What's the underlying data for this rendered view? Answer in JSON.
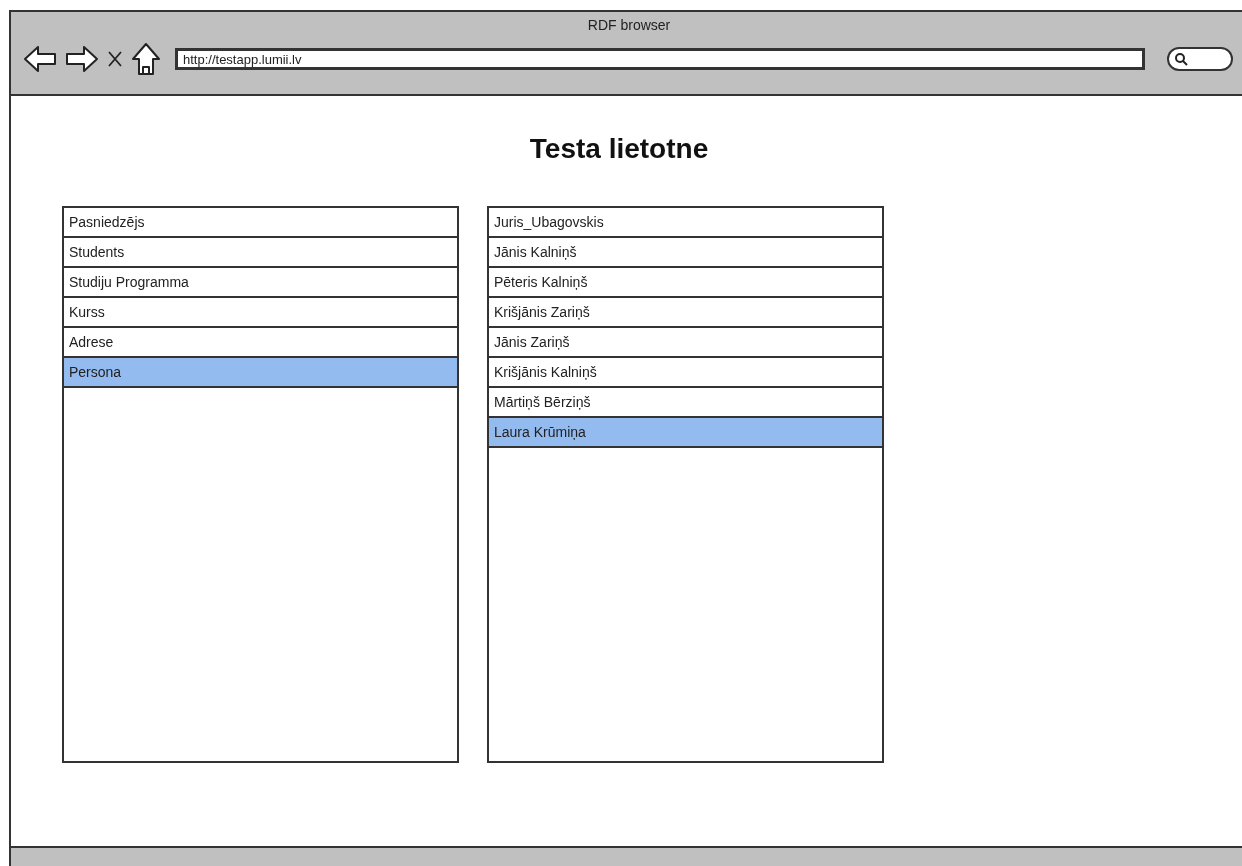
{
  "window": {
    "title": "RDF browser"
  },
  "address_bar": {
    "value": "http://testapp.lumii.lv"
  },
  "page": {
    "heading": "Testa lietotne"
  },
  "classes": [
    {
      "label": "Pasniedzējs",
      "selected": false
    },
    {
      "label": "Students",
      "selected": false
    },
    {
      "label": "Studiju Programma",
      "selected": false
    },
    {
      "label": "Kurss",
      "selected": false
    },
    {
      "label": "Adrese",
      "selected": false
    },
    {
      "label": "Persona",
      "selected": true
    }
  ],
  "instances": [
    {
      "label": "Juris_Ubagovskis",
      "selected": false
    },
    {
      "label": "Jānis Kalniņš",
      "selected": false
    },
    {
      "label": "Pēteris Kalniņš",
      "selected": false
    },
    {
      "label": "Krišjānis Zariņš",
      "selected": false
    },
    {
      "label": "Jānis Zariņš",
      "selected": false
    },
    {
      "label": "Krišjānis Kalniņš",
      "selected": false
    },
    {
      "label": "Mārtiņš Bērziņš",
      "selected": false
    },
    {
      "label": "Laura Krūmiņa",
      "selected": true
    }
  ]
}
